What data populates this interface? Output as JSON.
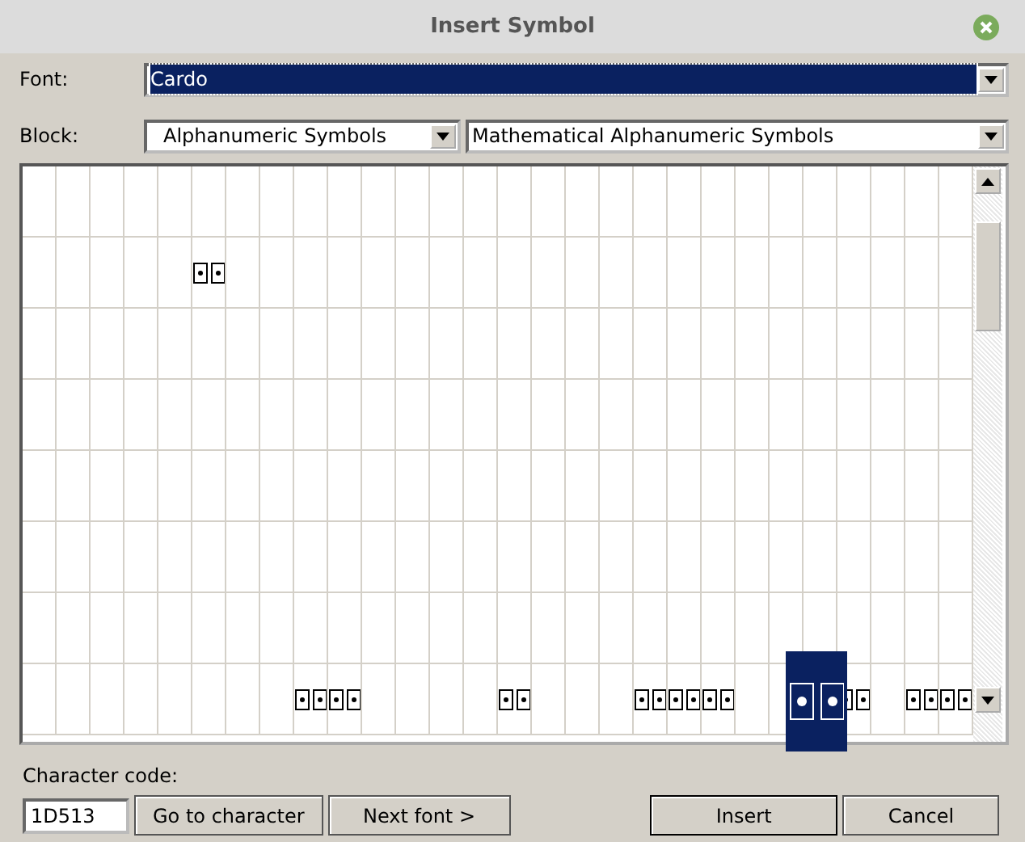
{
  "window": {
    "title": "Insert Symbol"
  },
  "font": {
    "label": "Font:",
    "value": "Cardo",
    "selected": true
  },
  "block": {
    "label": "Block:",
    "value": "Alphanumeric Symbols",
    "subset": "Mathematical Alphanumeric Symbols"
  },
  "grid": {
    "rows": [
      {
        "cells": [
          {
            "glyph": false
          },
          {
            "glyph": false
          },
          {
            "glyph": false
          },
          {
            "glyph": false
          },
          {
            "glyph": false
          },
          {
            "glyph": false
          },
          {
            "glyph": false
          },
          {
            "glyph": false
          },
          {
            "glyph": false
          },
          {
            "glyph": false
          },
          {
            "glyph": false
          },
          {
            "glyph": false
          },
          {
            "glyph": false
          },
          {
            "glyph": false
          },
          {
            "glyph": false
          },
          {
            "glyph": false
          },
          {
            "glyph": false
          },
          {
            "glyph": false
          },
          {
            "glyph": false
          },
          {
            "glyph": false
          },
          {
            "glyph": false
          },
          {
            "glyph": false
          },
          {
            "glyph": false
          },
          {
            "glyph": false
          },
          {
            "glyph": false
          },
          {
            "glyph": false
          },
          {
            "glyph": false
          },
          {
            "glyph": false
          }
        ]
      },
      {
        "cells": [
          {
            "glyph": false
          },
          {
            "glyph": false
          },
          {
            "glyph": false
          },
          {
            "glyph": false
          },
          {
            "glyph": false
          },
          {
            "glyph": true
          },
          {
            "glyph": false
          },
          {
            "glyph": false
          },
          {
            "glyph": false
          },
          {
            "glyph": false
          },
          {
            "glyph": false
          },
          {
            "glyph": false
          },
          {
            "glyph": false
          },
          {
            "glyph": false
          },
          {
            "glyph": false
          },
          {
            "glyph": false
          },
          {
            "glyph": false
          },
          {
            "glyph": false
          },
          {
            "glyph": false
          },
          {
            "glyph": false
          },
          {
            "glyph": false
          },
          {
            "glyph": false
          },
          {
            "glyph": false
          },
          {
            "glyph": false
          },
          {
            "glyph": false
          },
          {
            "glyph": false
          },
          {
            "glyph": false
          },
          {
            "glyph": false
          }
        ]
      },
      {
        "cells": [
          {
            "glyph": false
          },
          {
            "glyph": false
          },
          {
            "glyph": false
          },
          {
            "glyph": false
          },
          {
            "glyph": false
          },
          {
            "glyph": false
          },
          {
            "glyph": false
          },
          {
            "glyph": false
          },
          {
            "glyph": false
          },
          {
            "glyph": false
          },
          {
            "glyph": false
          },
          {
            "glyph": false
          },
          {
            "glyph": false
          },
          {
            "glyph": false
          },
          {
            "glyph": false
          },
          {
            "glyph": false
          },
          {
            "glyph": false
          },
          {
            "glyph": false
          },
          {
            "glyph": false
          },
          {
            "glyph": false
          },
          {
            "glyph": false
          },
          {
            "glyph": false
          },
          {
            "glyph": false
          },
          {
            "glyph": false
          },
          {
            "glyph": false
          },
          {
            "glyph": false
          },
          {
            "glyph": false
          },
          {
            "glyph": false
          }
        ]
      },
      {
        "cells": [
          {
            "glyph": false
          },
          {
            "glyph": false
          },
          {
            "glyph": false
          },
          {
            "glyph": false
          },
          {
            "glyph": false
          },
          {
            "glyph": false
          },
          {
            "glyph": false
          },
          {
            "glyph": false
          },
          {
            "glyph": false
          },
          {
            "glyph": false
          },
          {
            "glyph": false
          },
          {
            "glyph": false
          },
          {
            "glyph": false
          },
          {
            "glyph": false
          },
          {
            "glyph": false
          },
          {
            "glyph": false
          },
          {
            "glyph": false
          },
          {
            "glyph": false
          },
          {
            "glyph": false
          },
          {
            "glyph": false
          },
          {
            "glyph": false
          },
          {
            "glyph": false
          },
          {
            "glyph": false
          },
          {
            "glyph": false
          },
          {
            "glyph": false
          },
          {
            "glyph": false
          },
          {
            "glyph": false
          },
          {
            "glyph": false
          }
        ]
      },
      {
        "cells": [
          {
            "glyph": false
          },
          {
            "glyph": false
          },
          {
            "glyph": false
          },
          {
            "glyph": false
          },
          {
            "glyph": false
          },
          {
            "glyph": false
          },
          {
            "glyph": false
          },
          {
            "glyph": false
          },
          {
            "glyph": false
          },
          {
            "glyph": false
          },
          {
            "glyph": false
          },
          {
            "glyph": false
          },
          {
            "glyph": false
          },
          {
            "glyph": false
          },
          {
            "glyph": false
          },
          {
            "glyph": false
          },
          {
            "glyph": false
          },
          {
            "glyph": false
          },
          {
            "glyph": false
          },
          {
            "glyph": false
          },
          {
            "glyph": false
          },
          {
            "glyph": false
          },
          {
            "glyph": false
          },
          {
            "glyph": false
          },
          {
            "glyph": false
          },
          {
            "glyph": false
          },
          {
            "glyph": false
          },
          {
            "glyph": false
          }
        ]
      },
      {
        "cells": [
          {
            "glyph": false
          },
          {
            "glyph": false
          },
          {
            "glyph": false
          },
          {
            "glyph": false
          },
          {
            "glyph": false
          },
          {
            "glyph": false
          },
          {
            "glyph": false
          },
          {
            "glyph": false
          },
          {
            "glyph": false
          },
          {
            "glyph": false
          },
          {
            "glyph": false
          },
          {
            "glyph": false
          },
          {
            "glyph": false
          },
          {
            "glyph": false
          },
          {
            "glyph": false
          },
          {
            "glyph": false
          },
          {
            "glyph": false
          },
          {
            "glyph": false
          },
          {
            "glyph": false
          },
          {
            "glyph": false
          },
          {
            "glyph": false
          },
          {
            "glyph": false
          },
          {
            "glyph": false
          },
          {
            "glyph": false
          },
          {
            "glyph": false
          },
          {
            "glyph": false
          },
          {
            "glyph": false
          },
          {
            "glyph": false
          }
        ]
      },
      {
        "cells": [
          {
            "glyph": false
          },
          {
            "glyph": false
          },
          {
            "glyph": false
          },
          {
            "glyph": false
          },
          {
            "glyph": false
          },
          {
            "glyph": false
          },
          {
            "glyph": false
          },
          {
            "glyph": false
          },
          {
            "glyph": false
          },
          {
            "glyph": false
          },
          {
            "glyph": false
          },
          {
            "glyph": false
          },
          {
            "glyph": false
          },
          {
            "glyph": false
          },
          {
            "glyph": false
          },
          {
            "glyph": false
          },
          {
            "glyph": false
          },
          {
            "glyph": false
          },
          {
            "glyph": false
          },
          {
            "glyph": false
          },
          {
            "glyph": false
          },
          {
            "glyph": false
          },
          {
            "glyph": false
          },
          {
            "glyph": false
          },
          {
            "glyph": false
          },
          {
            "glyph": false
          },
          {
            "glyph": false
          },
          {
            "glyph": false
          }
        ]
      },
      {
        "cells": [
          {
            "glyph": false
          },
          {
            "glyph": false
          },
          {
            "glyph": false
          },
          {
            "glyph": false
          },
          {
            "glyph": false
          },
          {
            "glyph": false
          },
          {
            "glyph": false
          },
          {
            "glyph": false
          },
          {
            "glyph": true
          },
          {
            "glyph": true
          },
          {
            "glyph": false
          },
          {
            "glyph": false
          },
          {
            "glyph": false
          },
          {
            "glyph": false
          },
          {
            "glyph": true
          },
          {
            "glyph": false
          },
          {
            "glyph": false
          },
          {
            "glyph": false
          },
          {
            "glyph": true
          },
          {
            "glyph": true
          },
          {
            "glyph": true
          },
          {
            "glyph": false
          },
          {
            "glyph": false
          },
          {
            "glyph": true,
            "selected": true
          },
          {
            "glyph": true
          },
          {
            "glyph": false
          },
          {
            "glyph": true
          },
          {
            "glyph": true
          }
        ]
      }
    ]
  },
  "character_code": {
    "label": "Character code:",
    "value": "1D513"
  },
  "buttons": [
    "Go to character",
    "Next font >",
    "Insert",
    "Cancel"
  ]
}
